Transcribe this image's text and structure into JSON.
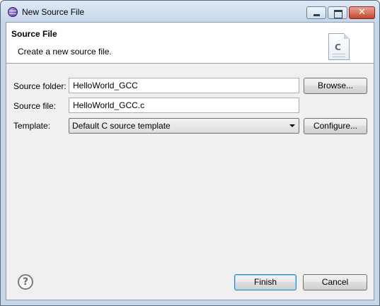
{
  "window": {
    "title": "New Source File",
    "close_glyph": "✕"
  },
  "banner": {
    "title": "Source File",
    "description": "Create a new source file.",
    "icon": "c-source-file-icon",
    "icon_letter": "C"
  },
  "form": {
    "source_folder": {
      "label": "Source folder:",
      "value": "HelloWorld_GCC",
      "button": "Browse..."
    },
    "source_file": {
      "label": "Source file:",
      "value": "HelloWorld_GCC.c"
    },
    "template": {
      "label": "Template:",
      "selected": "Default C source template",
      "button": "Configure..."
    }
  },
  "footer": {
    "help_icon": "help-icon",
    "help_glyph": "?",
    "finish": "Finish",
    "cancel": "Cancel"
  }
}
